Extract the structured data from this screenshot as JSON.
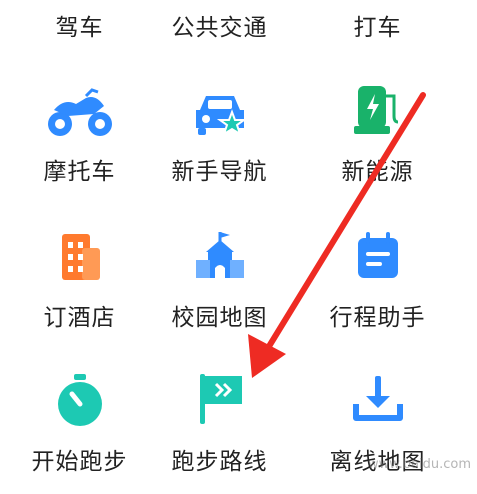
{
  "row0": [
    "驾车",
    "公共交通",
    "打车"
  ],
  "row1": [
    "摩托车",
    "新手导航",
    "新能源"
  ],
  "row2": [
    "订酒店",
    "校园地图",
    "行程助手"
  ],
  "row3": [
    "开始跑步",
    "跑步路线",
    "离线地图"
  ],
  "colors": {
    "blue": "#2f8bff",
    "teal": "#1dc9b3",
    "green": "#19b26a",
    "orange": "#ff7a2e",
    "arrow": "#ee2b23"
  },
  "icons": {
    "row1": [
      "motorcycle-icon",
      "new-driver-car-icon",
      "ev-charger-icon"
    ],
    "row2": [
      "hotel-building-icon",
      "campus-icon",
      "itinerary-calendar-icon"
    ],
    "row3": [
      "stopwatch-icon",
      "running-route-flag-icon",
      "offline-download-icon"
    ]
  },
  "watermark": "www.baidu.com"
}
